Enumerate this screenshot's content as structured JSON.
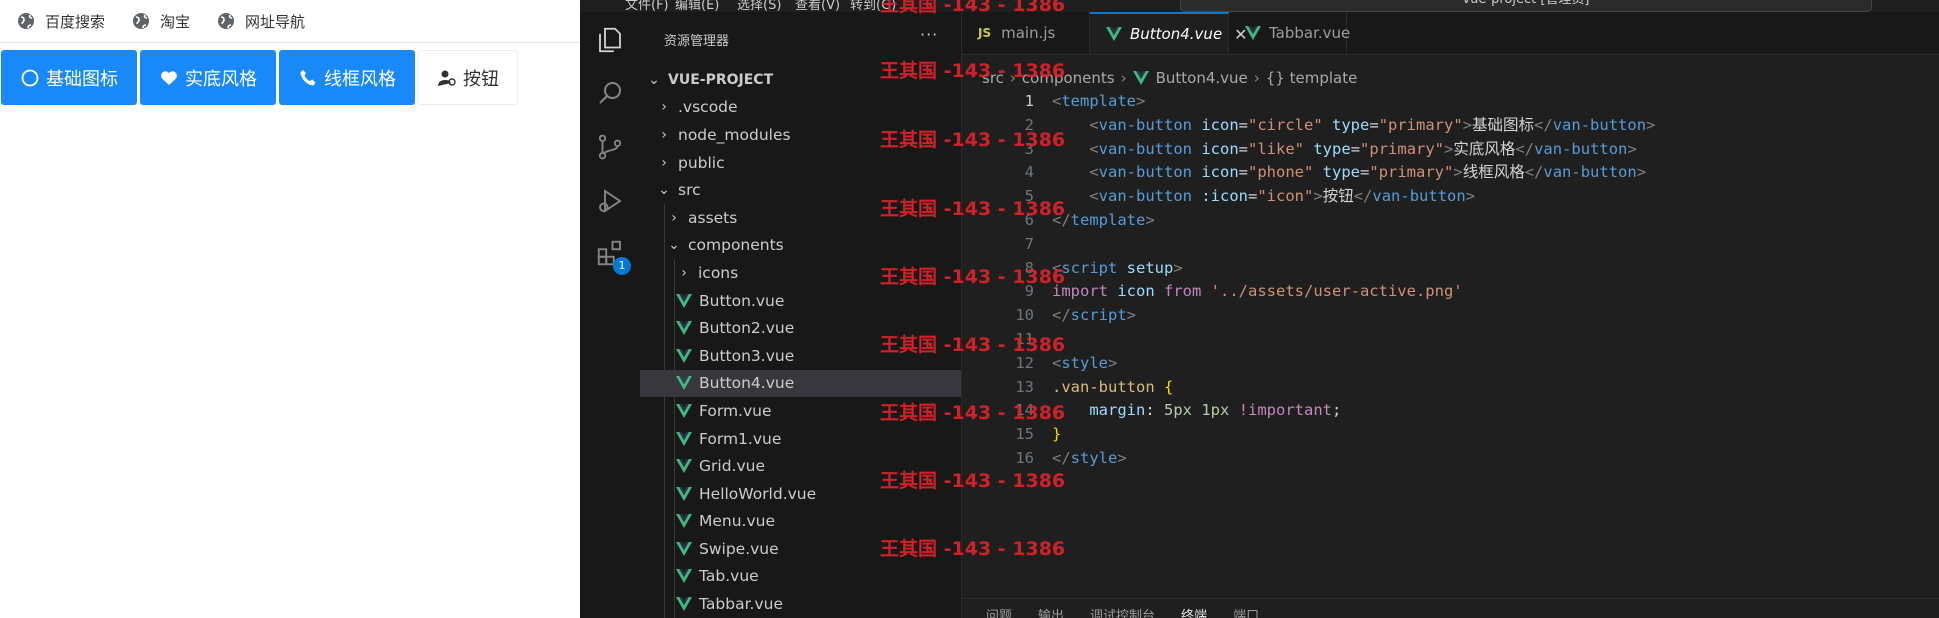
{
  "browser": {
    "bookmarks": [
      {
        "label": "百度搜索",
        "icon": "globe-icon"
      },
      {
        "label": "淘宝",
        "icon": "globe-icon"
      },
      {
        "label": "网址导航",
        "icon": "globe-icon"
      }
    ],
    "buttons": [
      {
        "label": "基础图标",
        "type": "primary",
        "icon": "circle-icon"
      },
      {
        "label": "实底风格",
        "type": "primary",
        "icon": "heart-icon"
      },
      {
        "label": "线框风格",
        "type": "primary",
        "icon": "phone-icon"
      },
      {
        "label": "按钮",
        "type": "default",
        "icon": "user-icon"
      }
    ],
    "colors": {
      "primary": "#1989fa"
    }
  },
  "vscode": {
    "title": "vue-project [管理员]",
    "menu": [
      "文件(F)",
      "编辑(E)",
      "选择(S)",
      "查看(V)",
      "转到(G)"
    ],
    "explorer": {
      "header": "资源管理器",
      "more": "···",
      "root": "VUE-PROJECT",
      "items": [
        {
          "label": ".vscode",
          "type": "folder"
        },
        {
          "label": "node_modules",
          "type": "folder"
        },
        {
          "label": "public",
          "type": "folder"
        },
        {
          "label": "src",
          "type": "folder-open"
        },
        {
          "label": "assets",
          "type": "folder"
        },
        {
          "label": "components",
          "type": "folder-open"
        },
        {
          "label": "icons",
          "type": "folder"
        },
        {
          "label": "Button.vue",
          "type": "vue"
        },
        {
          "label": "Button2.vue",
          "type": "vue"
        },
        {
          "label": "Button3.vue",
          "type": "vue"
        },
        {
          "label": "Button4.vue",
          "type": "vue",
          "selected": true
        },
        {
          "label": "Form.vue",
          "type": "vue"
        },
        {
          "label": "Form1.vue",
          "type": "vue"
        },
        {
          "label": "Grid.vue",
          "type": "vue"
        },
        {
          "label": "HelloWorld.vue",
          "type": "vue"
        },
        {
          "label": "Menu.vue",
          "type": "vue"
        },
        {
          "label": "Swipe.vue",
          "type": "vue"
        },
        {
          "label": "Tab.vue",
          "type": "vue"
        },
        {
          "label": "Tabbar.vue",
          "type": "vue"
        }
      ]
    },
    "activity_badge": "1",
    "tabs": [
      {
        "label": "main.js",
        "icon": "JS"
      },
      {
        "label": "Button4.vue",
        "icon": "vue",
        "active": true,
        "close": "✕"
      },
      {
        "label": "Tabbar.vue",
        "icon": "vue"
      }
    ],
    "breadcrumb": [
      "src",
      "components",
      "Button4.vue",
      "{} template"
    ],
    "code": [
      {
        "n": "1",
        "tokens": [
          [
            "<",
            "punct"
          ],
          [
            "template",
            "tag"
          ],
          [
            ">",
            "punct"
          ]
        ]
      },
      {
        "n": "2",
        "tokens": [
          [
            "    <",
            "punct"
          ],
          [
            "van-button",
            "tag"
          ],
          [
            " icon",
            "attr"
          ],
          [
            "=",
            "txt"
          ],
          [
            "\"circle\"",
            "str"
          ],
          [
            " type",
            "attr"
          ],
          [
            "=",
            "txt"
          ],
          [
            "\"primary\"",
            "str"
          ],
          [
            ">",
            "punct"
          ],
          [
            "基础图标",
            "txt"
          ],
          [
            "</",
            "punct"
          ],
          [
            "van-button",
            "tag"
          ],
          [
            ">",
            "punct"
          ]
        ]
      },
      {
        "n": "3",
        "tokens": [
          [
            "    <",
            "punct"
          ],
          [
            "van-button",
            "tag"
          ],
          [
            " icon",
            "attr"
          ],
          [
            "=",
            "txt"
          ],
          [
            "\"like\"",
            "str"
          ],
          [
            " type",
            "attr"
          ],
          [
            "=",
            "txt"
          ],
          [
            "\"primary\"",
            "str"
          ],
          [
            ">",
            "punct"
          ],
          [
            "实底风格",
            "txt"
          ],
          [
            "</",
            "punct"
          ],
          [
            "van-button",
            "tag"
          ],
          [
            ">",
            "punct"
          ]
        ]
      },
      {
        "n": "4",
        "tokens": [
          [
            "    <",
            "punct"
          ],
          [
            "van-button",
            "tag"
          ],
          [
            " icon",
            "attr"
          ],
          [
            "=",
            "txt"
          ],
          [
            "\"phone\"",
            "str"
          ],
          [
            " type",
            "attr"
          ],
          [
            "=",
            "txt"
          ],
          [
            "\"primary\"",
            "str"
          ],
          [
            ">",
            "punct"
          ],
          [
            "线框风格",
            "txt"
          ],
          [
            "</",
            "punct"
          ],
          [
            "van-button",
            "tag"
          ],
          [
            ">",
            "punct"
          ]
        ]
      },
      {
        "n": "5",
        "tokens": [
          [
            "    <",
            "punct"
          ],
          [
            "van-button",
            "tag"
          ],
          [
            " :icon",
            "attr"
          ],
          [
            "=",
            "txt"
          ],
          [
            "\"icon\"",
            "str"
          ],
          [
            ">",
            "punct"
          ],
          [
            "按钮",
            "txt"
          ],
          [
            "</",
            "punct"
          ],
          [
            "van-button",
            "tag"
          ],
          [
            ">",
            "punct"
          ]
        ]
      },
      {
        "n": "6",
        "tokens": [
          [
            "</",
            "punct"
          ],
          [
            "template",
            "tag"
          ],
          [
            ">",
            "punct"
          ]
        ]
      },
      {
        "n": "7",
        "tokens": []
      },
      {
        "n": "8",
        "tokens": [
          [
            "<",
            "punct"
          ],
          [
            "script",
            "tag"
          ],
          [
            " setup",
            "attr"
          ],
          [
            ">",
            "punct"
          ]
        ]
      },
      {
        "n": "9",
        "tokens": [
          [
            "import",
            "kw"
          ],
          [
            " icon ",
            "attr"
          ],
          [
            "from",
            "kw"
          ],
          [
            " ",
            "txt"
          ],
          [
            "'../assets/user-active.png'",
            "str"
          ]
        ]
      },
      {
        "n": "10",
        "tokens": [
          [
            "</",
            "punct"
          ],
          [
            "script",
            "tag"
          ],
          [
            ">",
            "punct"
          ]
        ]
      },
      {
        "n": "11",
        "tokens": []
      },
      {
        "n": "12",
        "tokens": [
          [
            "<",
            "punct"
          ],
          [
            "style",
            "tag"
          ],
          [
            ">",
            "punct"
          ]
        ]
      },
      {
        "n": "13",
        "tokens": [
          [
            ".van-button",
            "sel"
          ],
          [
            " ",
            "txt"
          ],
          [
            "{",
            "brace"
          ]
        ]
      },
      {
        "n": "14",
        "tokens": [
          [
            "    margin",
            "attr"
          ],
          [
            ": ",
            "txt"
          ],
          [
            "5px",
            "num"
          ],
          [
            " ",
            "txt"
          ],
          [
            "1px",
            "num"
          ],
          [
            " ",
            "txt"
          ],
          [
            "!important",
            "kw"
          ],
          [
            ";",
            "txt"
          ]
        ]
      },
      {
        "n": "15",
        "tokens": [
          [
            "}",
            "brace"
          ]
        ]
      },
      {
        "n": "16",
        "tokens": [
          [
            "</",
            "punct"
          ],
          [
            "style",
            "tag"
          ],
          [
            ">",
            "punct"
          ]
        ]
      }
    ],
    "panel_tabs": [
      "问题",
      "输出",
      "调试控制台",
      "终端",
      "端口"
    ],
    "active_panel": "终端"
  },
  "watermark": "王其国 -143 - 1386"
}
